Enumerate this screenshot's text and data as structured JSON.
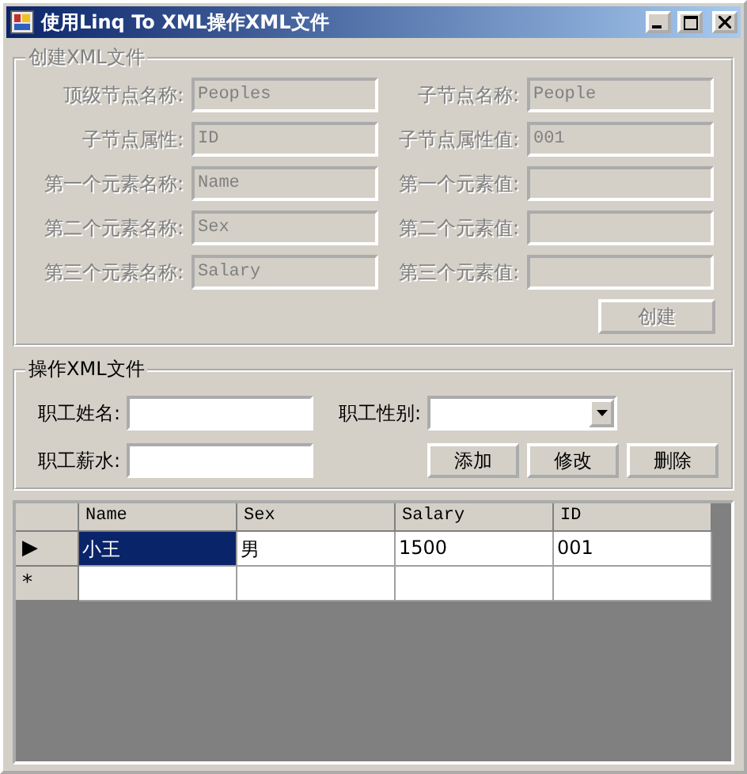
{
  "window": {
    "title": "使用Linq To XML操作XML文件"
  },
  "create_group": {
    "title": "创建XML文件",
    "disabled": true,
    "fields": [
      {
        "label": "顶级节点名称:",
        "value": "Peoples"
      },
      {
        "label": "子节点名称:",
        "value": "People"
      },
      {
        "label": "子节点属性:",
        "value": "ID"
      },
      {
        "label": "子节点属性值:",
        "value": "001"
      },
      {
        "label": "第一个元素名称:",
        "value": "Name"
      },
      {
        "label": "第一个元素值:"
      },
      {
        "label": "第二个元素名称:",
        "value": "Sex"
      },
      {
        "label": "第二个元素值:"
      },
      {
        "label": "第三个元素名称:",
        "value": "Salary"
      },
      {
        "label": "第三个元素值:"
      }
    ],
    "button": "创建"
  },
  "edit_group": {
    "title": "操作XML文件",
    "disabled": false,
    "name_label": "职工姓名:",
    "sex_label": "职工性别:",
    "salary_label": "职工薪水:",
    "buttons": [
      "添加",
      "修改",
      "删除"
    ]
  },
  "grid": {
    "columns": [
      "Name",
      "Sex",
      "Salary",
      "ID"
    ],
    "rows": [
      {
        "indicator": "▶",
        "cells": [
          {
            "text": "小王",
            "selected": true
          },
          {
            "text": "男",
            "selected": false
          },
          {
            "text": "1500",
            "selected": false
          },
          {
            "text": "001",
            "selected": false
          }
        ]
      },
      {
        "indicator": "*",
        "cells": []
      }
    ]
  }
}
